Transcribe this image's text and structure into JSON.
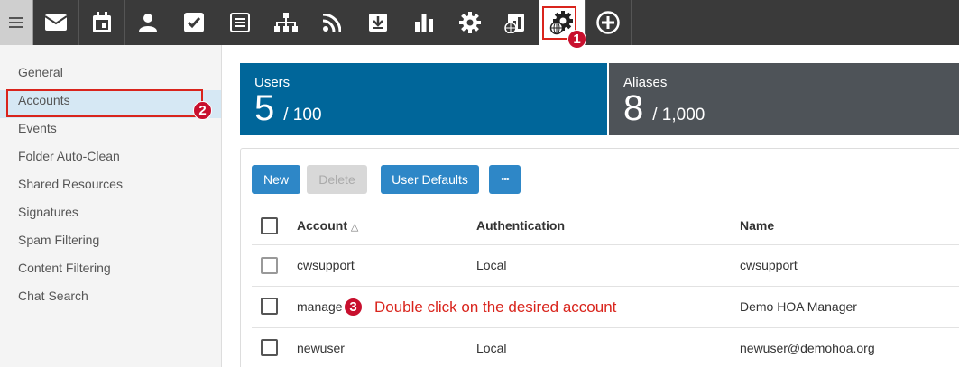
{
  "toolbar": {
    "items": [
      "menu-icon",
      "mail-icon",
      "calendar-icon",
      "contacts-icon",
      "tasks-icon",
      "notes-icon",
      "sitemap-icon",
      "rss-icon",
      "download-icon",
      "chart-icon",
      "settings-icon",
      "domain-reports-icon",
      "domain-settings-icon",
      "add-icon"
    ],
    "active": "domain-settings-icon",
    "step1": "1"
  },
  "sidebar": {
    "items": [
      "General",
      "Accounts",
      "Events",
      "Folder Auto-Clean",
      "Shared Resources",
      "Signatures",
      "Spam Filtering",
      "Content Filtering",
      "Chat Search"
    ],
    "selected": "Accounts",
    "step2": "2"
  },
  "stats": {
    "users": {
      "title": "Users",
      "count": "5",
      "limit": "/ 100"
    },
    "aliases": {
      "title": "Aliases",
      "count": "8",
      "limit": "/ 1,000"
    }
  },
  "actions": {
    "new": "New",
    "delete": "Delete",
    "user_defaults": "User Defaults",
    "more": "•••"
  },
  "table": {
    "headers": {
      "account": "Account",
      "sort_icon": "△",
      "authentication": "Authentication",
      "name": "Name"
    },
    "rows": [
      {
        "account": "cwsupport",
        "authentication": "Local",
        "name": "cwsupport"
      },
      {
        "account": "manage",
        "authentication": "",
        "name": "Demo HOA Manager"
      },
      {
        "account": "newuser",
        "authentication": "Local",
        "name": "newuser@demohoa.org"
      }
    ]
  },
  "annotation": {
    "step3": "3",
    "text": "Double click on the desired account"
  },
  "colors": {
    "toolbar": "#3a3a3a",
    "users_card": "#00669a",
    "aliases_card": "#4e5358",
    "button": "#2e87c7",
    "highlight": "#d9241c"
  }
}
